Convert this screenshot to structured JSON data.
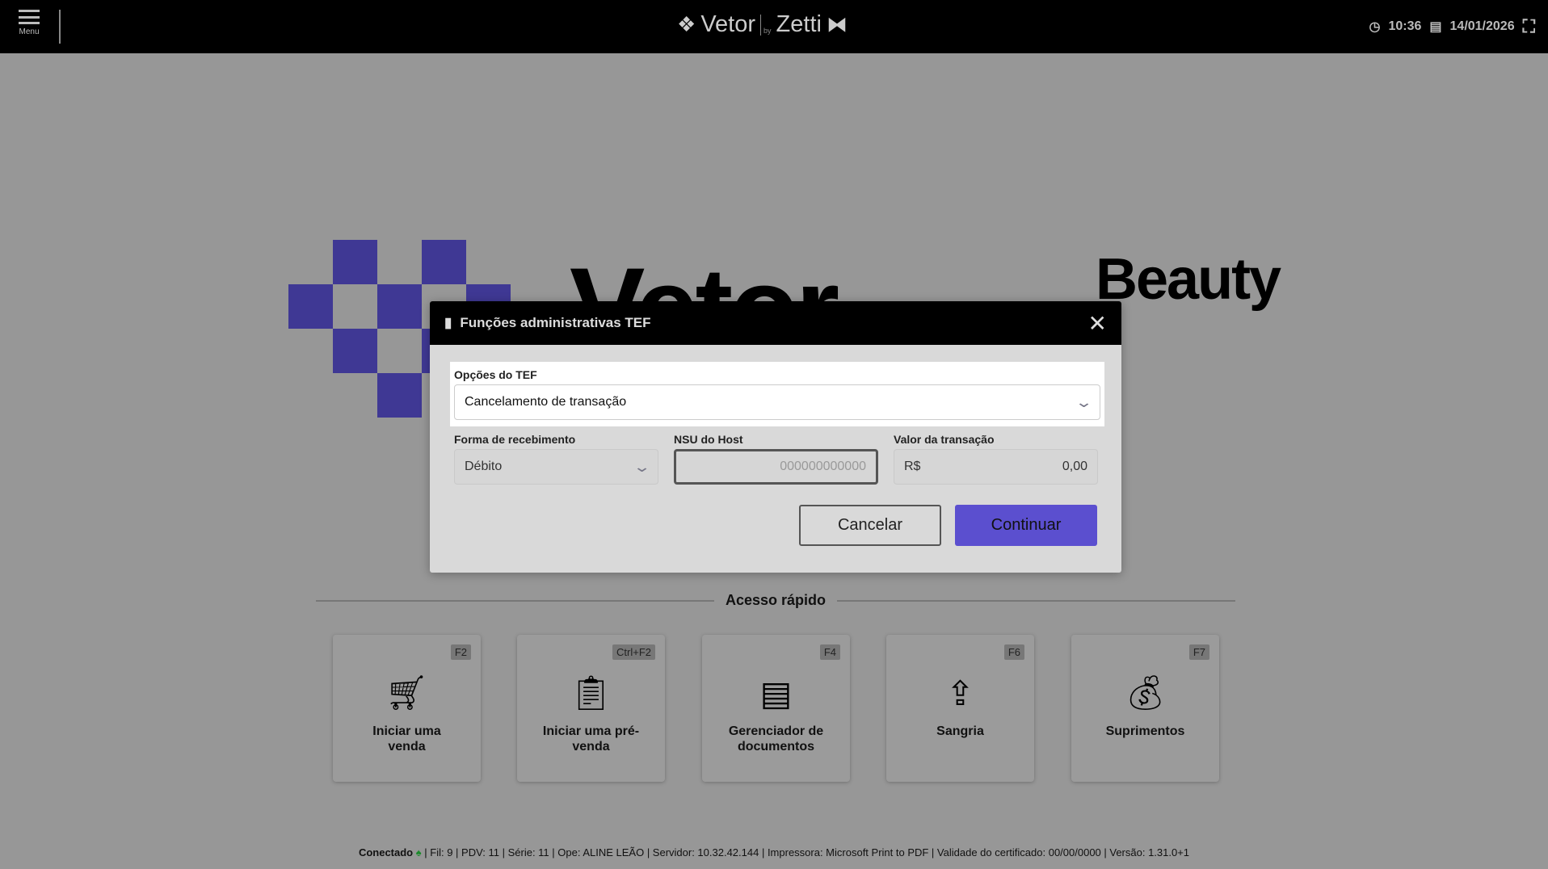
{
  "header": {
    "menu_label": "Menu",
    "brand_left": "Vetor",
    "brand_by": "by",
    "brand_right": "Zetti",
    "time": "10:36",
    "date": "14/01/2026"
  },
  "background": {
    "word": "Vetor",
    "beauty": "Beauty"
  },
  "dialog": {
    "title": "Funções administrativas TEF",
    "tef_options_label": "Opções do TEF",
    "tef_option_value": "Cancelamento de transação",
    "payment_label": "Forma de recebimento",
    "payment_value": "Débito",
    "nsu_label": "NSU do Host",
    "nsu_placeholder": "000000000000",
    "amount_label": "Valor da transação",
    "currency": "R$",
    "amount_value": "0,00",
    "cancel_label": "Cancelar",
    "continue_label": "Continuar"
  },
  "quick_access": {
    "title": "Acesso rápido",
    "cards": [
      {
        "key": "F2",
        "label": "Iniciar uma venda",
        "icon": "cart-icon"
      },
      {
        "key": "Ctrl+F2",
        "label": "Iniciar uma pré-venda",
        "icon": "clipboard-icon"
      },
      {
        "key": "F4",
        "label": "Gerenciador de documentos",
        "icon": "document-icon"
      },
      {
        "key": "F6",
        "label": "Sangria",
        "icon": "money-out-icon"
      },
      {
        "key": "F7",
        "label": "Suprimentos",
        "icon": "money-bag-icon"
      }
    ]
  },
  "footer": {
    "connected": "Conectado",
    "info": "| Fil: 9 | PDV: 11 | Série: 11 | Ope: ALINE LEÃO | Servidor: 10.32.42.144 | Impressora: Microsoft Print to PDF | Validade do certificado: 00/00/0000 | Versão: 1.31.0+1"
  },
  "colors": {
    "accent": "#5b4fcf",
    "logo_purple": "#3f3894"
  }
}
